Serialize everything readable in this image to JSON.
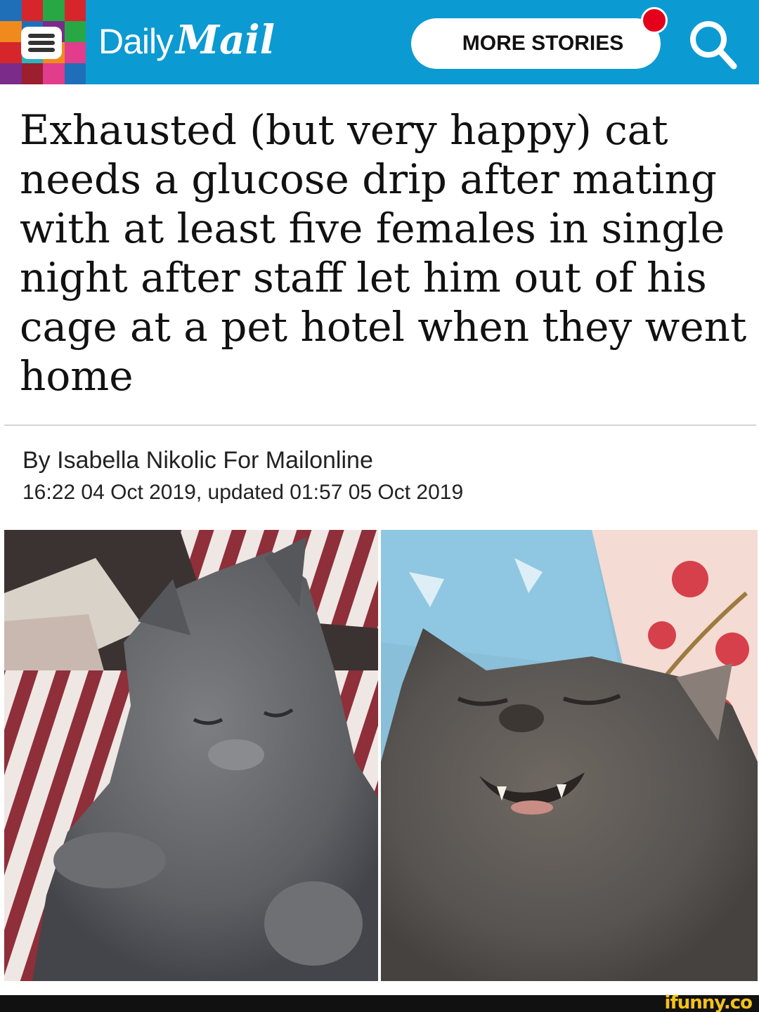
{
  "header": {
    "brand_daily": "Daily",
    "brand_mail": "Mail",
    "more_stories_label": "MORE STORIES",
    "menu_icon": "hamburger-menu-icon",
    "search_icon": "search-icon",
    "background_color": "#0c9ad2",
    "notification_color": "#e4001b"
  },
  "article": {
    "headline": "Exhausted (but very happy) cat needs a glucose drip after mating with at least five females in single night after staff let him out of his cage at a pet hotel when they went home",
    "byline": "By Isabella Nikolic For Mailonline",
    "dateline": "16:22 04 Oct 2019, updated 01:57 05 Oct 2019"
  },
  "images": [
    {
      "subject": "grey cat lying on striped bedding"
    },
    {
      "subject": "grey cat grinning with eyes closed on floral bedding"
    }
  ],
  "watermark": "ifunny.co"
}
